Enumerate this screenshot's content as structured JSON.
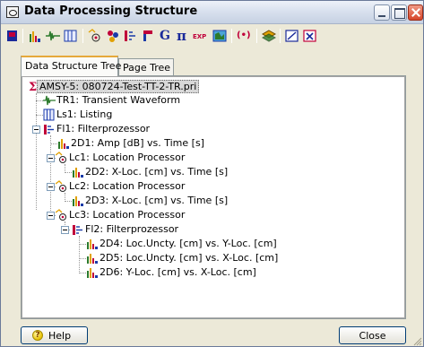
{
  "window": {
    "title": "Data Processing Structure"
  },
  "toolbar": {
    "buttons": [
      {
        "icon": "stop-icon"
      },
      {
        "icon": "bar-chart-icon"
      },
      {
        "icon": "waveform-icon"
      },
      {
        "icon": "listing-icon"
      },
      {
        "icon": "location-processor-icon"
      },
      {
        "icon": "cluster-icon"
      },
      {
        "icon": "filter-icon"
      },
      {
        "icon": "feature-icon"
      },
      {
        "icon": "g-icon",
        "text": "G"
      },
      {
        "icon": "pi-icon",
        "text": "π"
      },
      {
        "icon": "export-icon",
        "text": "EXP"
      },
      {
        "icon": "map-icon"
      },
      {
        "icon": "signal-icon",
        "text": "(•)"
      },
      {
        "icon": "layers-icon"
      },
      {
        "icon": "edit-icon"
      },
      {
        "icon": "function-icon",
        "text": "x"
      }
    ],
    "accent_colors": [
      "#c0003a",
      "#e1a000",
      "#2c7a2c",
      "#1a3aa8"
    ]
  },
  "tabs": [
    {
      "label": "Data Structure Tree",
      "active": true
    },
    {
      "label": "Page Tree",
      "active": false
    }
  ],
  "tree": {
    "root": "AMSY-5: 080724-Test-TT-2-TR.pri",
    "nodes": [
      {
        "label": "TR1: Transient Waveform",
        "icon": "waveform-icon"
      },
      {
        "label": "Ls1: Listing",
        "icon": "listing-icon"
      },
      {
        "label": "Fl1: Filterprozessor",
        "icon": "filter-icon"
      },
      {
        "label": "2D1: Amp [dB] vs. Time [s]",
        "icon": "bar-chart-icon"
      },
      {
        "label": "Lc1: Location Processor",
        "icon": "location-processor-icon"
      },
      {
        "label": "2D2: X-Loc. [cm] vs. Time [s]",
        "icon": "bar-chart-icon"
      },
      {
        "label": "Lc2: Location Processor",
        "icon": "location-processor-icon"
      },
      {
        "label": "2D3: X-Loc. [cm] vs. Time [s]",
        "icon": "bar-chart-icon"
      },
      {
        "label": "Lc3: Location Processor",
        "icon": "location-processor-icon"
      },
      {
        "label": "Fl2: Filterprozessor",
        "icon": "filter-icon"
      },
      {
        "label": "2D4: Loc.Uncty. [cm] vs. Y-Loc. [cm]",
        "icon": "bar-chart-icon"
      },
      {
        "label": "2D5: Loc.Uncty. [cm] vs. X-Loc. [cm]",
        "icon": "bar-chart-icon"
      },
      {
        "label": "2D6: Y-Loc. [cm] vs. X-Loc. [cm]",
        "icon": "bar-chart-icon"
      }
    ]
  },
  "buttons": {
    "help_label": "Help",
    "help_mnemonic_icon": "?",
    "close_label": "Close"
  }
}
